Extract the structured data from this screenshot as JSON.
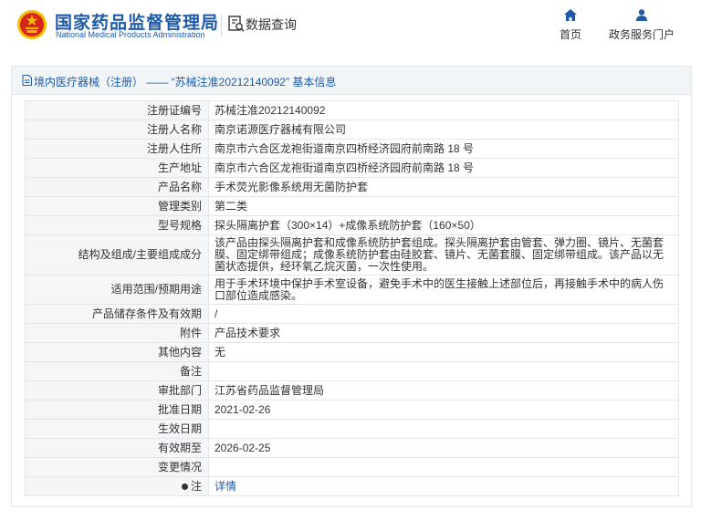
{
  "header": {
    "org_cn": "国家药品监督管理局",
    "org_en": "National Medical Products Administration",
    "query_label": "数据查询",
    "nav": {
      "home": "首页",
      "portal": "政务服务门户"
    }
  },
  "panel": {
    "title": "境内医疗器械（注册） —— “苏械注准20212140092” 基本信息"
  },
  "rows": [
    {
      "key": "注册证编号",
      "value": "苏械注准20212140092"
    },
    {
      "key": "注册人名称",
      "value": "南京诺源医疗器械有限公司"
    },
    {
      "key": "注册人住所",
      "value": "南京市六合区龙袍街道南京四桥经济园府前南路 18 号"
    },
    {
      "key": "生产地址",
      "value": "南京市六合区龙袍街道南京四桥经济园府前南路 18 号"
    },
    {
      "key": "产品名称",
      "value": "手术荧光影像系统用无菌防护套"
    },
    {
      "key": "管理类别",
      "value": "第二类"
    },
    {
      "key": "型号规格",
      "value": "探头隔离护套（300×14）+成像系统防护套（160×50）"
    },
    {
      "key": "结构及组成/主要组成成分",
      "value": "该产品由探头隔离护套和成像系统防护套组成。探头隔离护套由管套、弹力圈、镜片、无菌套膜、固定绑带组成；成像系统防护套由硅胶套、镜片、无菌套膜、固定绑带组成。该产品以无菌状态提供，经环氧乙烷灭菌，一次性使用。"
    },
    {
      "key": "适用范围/预期用途",
      "value": "用于手术环境中保护手术室设备，避免手术中的医生接触上述部位后，再接触手术中的病人伤口部位造成感染。"
    },
    {
      "key": "产品储存条件及有效期",
      "value": "/"
    },
    {
      "key": "附件",
      "value": "产品技术要求"
    },
    {
      "key": "其他内容",
      "value": "无"
    },
    {
      "key": "备注",
      "value": ""
    },
    {
      "key": "审批部门",
      "value": "江苏省药品监督管理局"
    },
    {
      "key": "批准日期",
      "value": "2021-02-26"
    },
    {
      "key": "生效日期",
      "value": ""
    },
    {
      "key": "有效期至",
      "value": "2026-02-25"
    },
    {
      "key": "变更情况",
      "value": ""
    }
  ],
  "note_row": {
    "key": "注",
    "link": "详情"
  },
  "colors": {
    "brand_blue": "#1f5aa6",
    "emblem_red": "#d6261c",
    "emblem_gold": "#f3c000"
  },
  "icons": {
    "emblem": "national-emblem-icon",
    "query": "document-search-icon",
    "home": "home-icon",
    "portal": "user-icon",
    "title": "document-icon"
  }
}
